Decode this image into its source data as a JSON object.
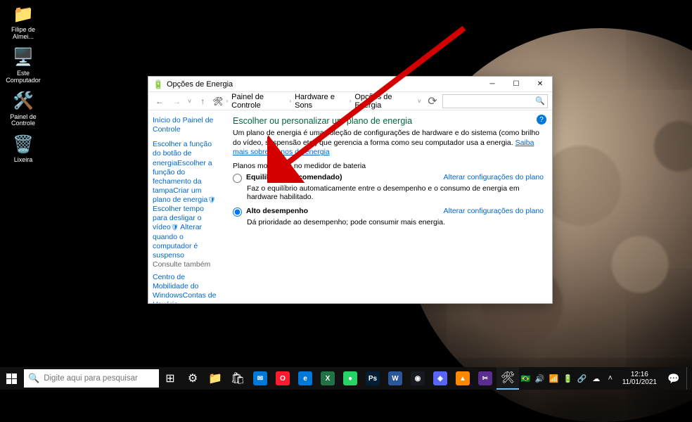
{
  "desktop": {
    "icons": [
      {
        "name": "user-folder",
        "glyph": "📁",
        "label": "Filipe de Almei..."
      },
      {
        "name": "this-pc",
        "glyph": "🖥️",
        "label": "Este Computador"
      },
      {
        "name": "control-panel",
        "glyph": "🛠️",
        "label": "Painel de Controle"
      },
      {
        "name": "recycle-bin",
        "glyph": "🗑️",
        "label": "Lixeira"
      }
    ]
  },
  "window": {
    "title": "Opções de Energia",
    "breadcrumbs": [
      "Painel de Controle",
      "Hardware e Sons",
      "Opções de Energia"
    ],
    "search_placeholder": "",
    "sidebar_home": "Início do Painel de Controle",
    "sidebar_links": [
      {
        "text": "Escolher a função do botão de energia",
        "shield": false
      },
      {
        "text": "Escolher a função do fechamento da tampa",
        "shield": false
      },
      {
        "text": "Criar um plano de energia",
        "shield": false
      },
      {
        "text": "Escolher tempo para desligar o vídeo",
        "shield": true
      },
      {
        "text": "Alterar quando o computador é suspenso",
        "shield": true
      }
    ],
    "see_also_title": "Consulte também",
    "see_also": [
      "Centro de Mobilidade do Windows",
      "Contas de Usuário"
    ],
    "main": {
      "heading": "Escolher ou personalizar um plano de energia",
      "desc": "Um plano de energia é uma coleção de configurações de hardware e do sistema (como brilho do vídeo, suspensão etc.) que gerencia a forma como seu computador usa a energia. ",
      "desc_link": "Saiba mais sobre planos de energia",
      "subhead": "Planos mostrados no medidor de bateria",
      "change_link": "Alterar configurações do plano",
      "plans": [
        {
          "name": "Equilibrado (recomendado)",
          "desc": "Faz o equilíbrio automaticamente entre o desempenho e o consumo de energia em hardware habilitado.",
          "selected": false
        },
        {
          "name": "Alto desempenho",
          "desc": "Dá prioridade ao desempenho; pode consumir mais energia.",
          "selected": true
        }
      ]
    }
  },
  "taskbar": {
    "search_placeholder": "Digite aqui para pesquisar",
    "apps": [
      {
        "name": "task-view",
        "glyph": "⊞",
        "bg": "transparent"
      },
      {
        "name": "settings",
        "glyph": "⚙",
        "bg": "transparent"
      },
      {
        "name": "file-explorer",
        "glyph": "📁",
        "bg": "transparent"
      },
      {
        "name": "store",
        "glyph": "🛍",
        "bg": "transparent"
      },
      {
        "name": "mail",
        "glyph": "✉",
        "bg": "#0078d7"
      },
      {
        "name": "opera",
        "glyph": "O",
        "bg": "#ff1b2d"
      },
      {
        "name": "edge",
        "glyph": "e",
        "bg": "#0078d7"
      },
      {
        "name": "excel",
        "glyph": "X",
        "bg": "#217346"
      },
      {
        "name": "whatsapp",
        "glyph": "●",
        "bg": "#25d366"
      },
      {
        "name": "photoshop",
        "glyph": "Ps",
        "bg": "#001e36"
      },
      {
        "name": "word",
        "glyph": "W",
        "bg": "#2b579a"
      },
      {
        "name": "steam",
        "glyph": "◉",
        "bg": "#171a21"
      },
      {
        "name": "discord",
        "glyph": "◈",
        "bg": "#5865f2"
      },
      {
        "name": "vlc",
        "glyph": "▲",
        "bg": "#ff8800"
      },
      {
        "name": "snipping",
        "glyph": "✂",
        "bg": "#5c2d91"
      },
      {
        "name": "control-panel",
        "glyph": "🛠",
        "bg": "transparent",
        "active": true
      }
    ],
    "tray": [
      "˄",
      "☁",
      "🔗",
      "🔋",
      "📶",
      "🔊",
      "🇧🇷"
    ],
    "time": "12:16",
    "date": "11/01/2021"
  }
}
